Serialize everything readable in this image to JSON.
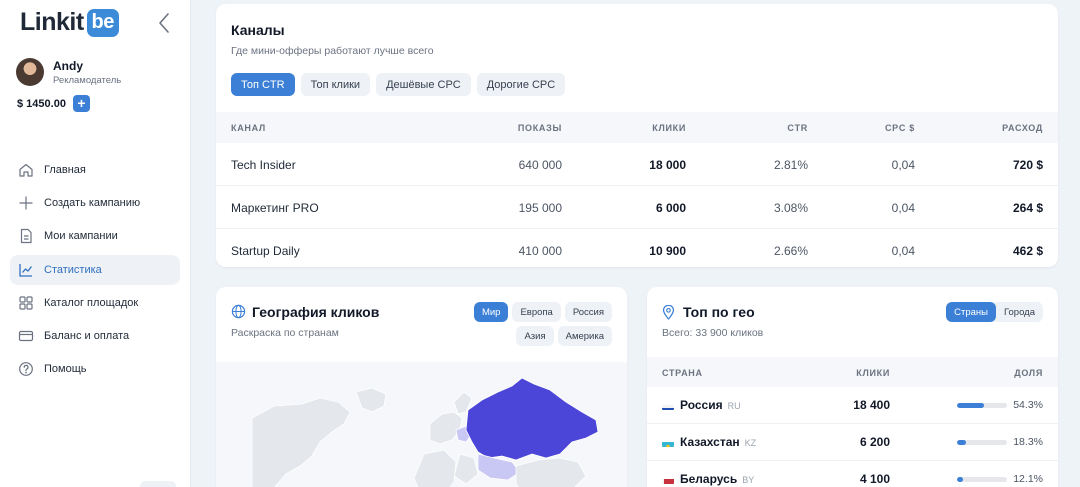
{
  "brand": {
    "logo_text": "Linkit",
    "logo_badge": "be"
  },
  "user": {
    "name": "Andy",
    "role": "Рекламодатель",
    "balance": "$ 1450.00",
    "add_label": "+"
  },
  "nav": [
    {
      "label": "Главная",
      "icon": "home-icon"
    },
    {
      "label": "Создать кампанию",
      "icon": "plus-icon"
    },
    {
      "label": "Мои кампании",
      "icon": "document-icon"
    },
    {
      "label": "Статистика",
      "icon": "chart-icon",
      "active": true
    },
    {
      "label": "Каталог площадок",
      "icon": "grid-icon"
    },
    {
      "label": "Баланс и оплата",
      "icon": "card-icon"
    },
    {
      "label": "Помощь",
      "icon": "help-icon"
    }
  ],
  "channels": {
    "title": "Каналы",
    "subtitle": "Где мини-офферы работают лучше всего",
    "tabs": [
      {
        "label": "Топ CTR",
        "active": true
      },
      {
        "label": "Топ клики"
      },
      {
        "label": "Дешёвые CPC"
      },
      {
        "label": "Дорогие CPC"
      }
    ],
    "columns": [
      "КАНАЛ",
      "ПОКАЗЫ",
      "КЛИКИ",
      "CTR",
      "CPC $",
      "РАСХОД"
    ],
    "rows": [
      {
        "name": "Tech Insider",
        "impressions": "640 000",
        "clicks": "18 000",
        "ctr": "2.81%",
        "cpc": "0,04",
        "spend": "720 $"
      },
      {
        "name": "Маркетинг PRO",
        "impressions": "195 000",
        "clicks": "6 000",
        "ctr": "3.08%",
        "cpc": "0,04",
        "spend": "264 $"
      },
      {
        "name": "Startup Daily",
        "impressions": "410 000",
        "clicks": "10 900",
        "ctr": "2.66%",
        "cpc": "0,04",
        "spend": "462 $"
      }
    ]
  },
  "geo_map": {
    "title": "География кликов",
    "subtitle": "Раскраска по странам",
    "icon": "globe-icon",
    "regions": [
      {
        "label": "Мир",
        "active": true
      },
      {
        "label": "Европа"
      },
      {
        "label": "Россия"
      },
      {
        "label": "Азия"
      },
      {
        "label": "Америка"
      }
    ],
    "colors": {
      "highlight": "#4b46d8",
      "light": "#c9c7f3",
      "land": "#e4e7ec"
    }
  },
  "top_geo": {
    "title": "Топ по гео",
    "subtitle": "Всего: 33 900 кликов",
    "icon": "pin-icon",
    "toggle": [
      {
        "label": "Страны",
        "active": true
      },
      {
        "label": "Города"
      }
    ],
    "columns": [
      "СТРАНА",
      "КЛИКИ",
      "ДОЛЯ"
    ],
    "rows": [
      {
        "name": "Россия",
        "code": "RU",
        "clicks": "18 400",
        "share": "54.3%",
        "share_value": 0.543
      },
      {
        "name": "Казахстан",
        "code": "KZ",
        "clicks": "6 200",
        "share": "18.3%",
        "share_value": 0.183
      },
      {
        "name": "Беларусь",
        "code": "BY",
        "clicks": "4 100",
        "share": "12.1%",
        "share_value": 0.121
      }
    ]
  }
}
